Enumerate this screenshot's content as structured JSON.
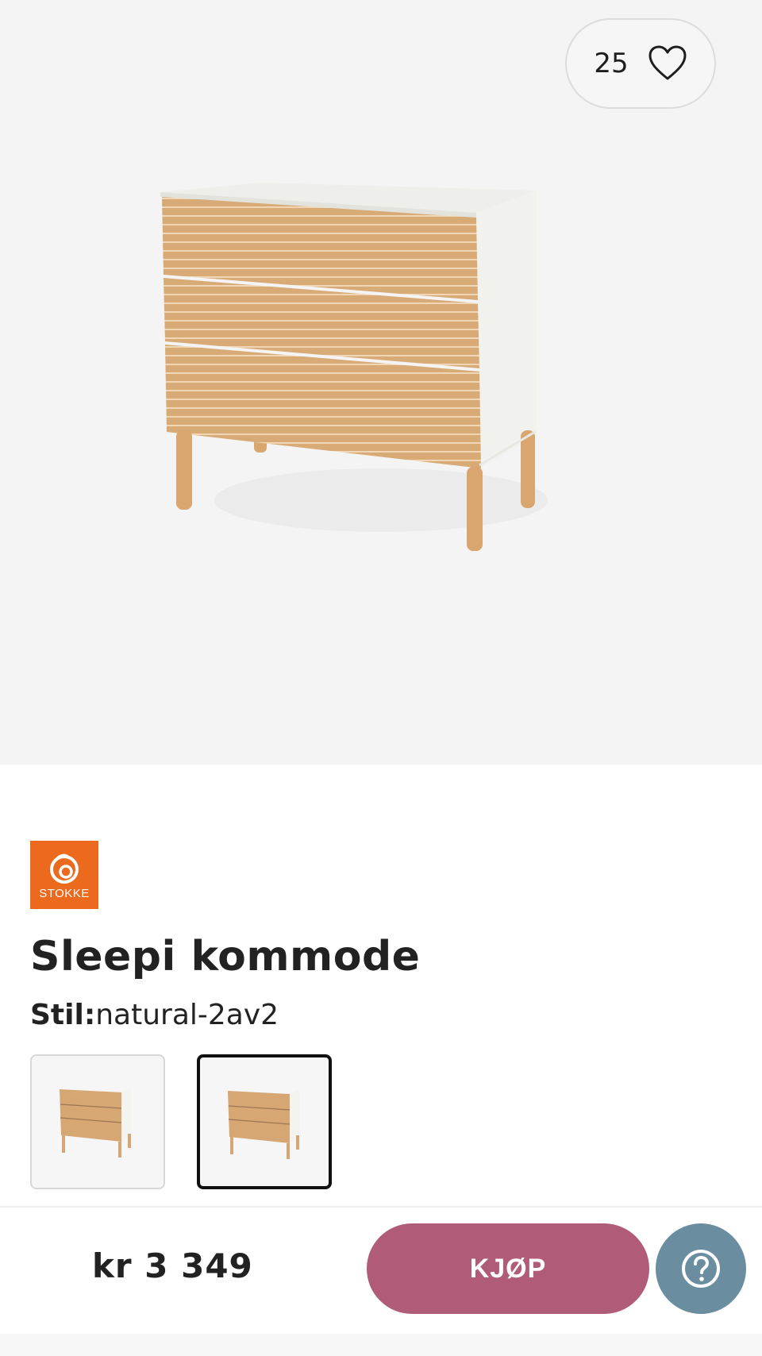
{
  "favorite": {
    "count": "25",
    "icon": "heart-outline-icon"
  },
  "product_image": {
    "icon": "dresser-product-image"
  },
  "brand": {
    "name": "STOKKE",
    "color": "#ec6a1e"
  },
  "product": {
    "title": "Sleepi kommode",
    "style_label": "Stil:",
    "style_value": "natural-2av2"
  },
  "variants": [
    {
      "selected": false
    },
    {
      "selected": true
    }
  ],
  "purchase_bar": {
    "price": "kr 3 349",
    "buy_label": "KJØP",
    "buy_color": "#b05b78",
    "help_icon": "question-circle-icon",
    "help_color": "#6a8d9f"
  }
}
